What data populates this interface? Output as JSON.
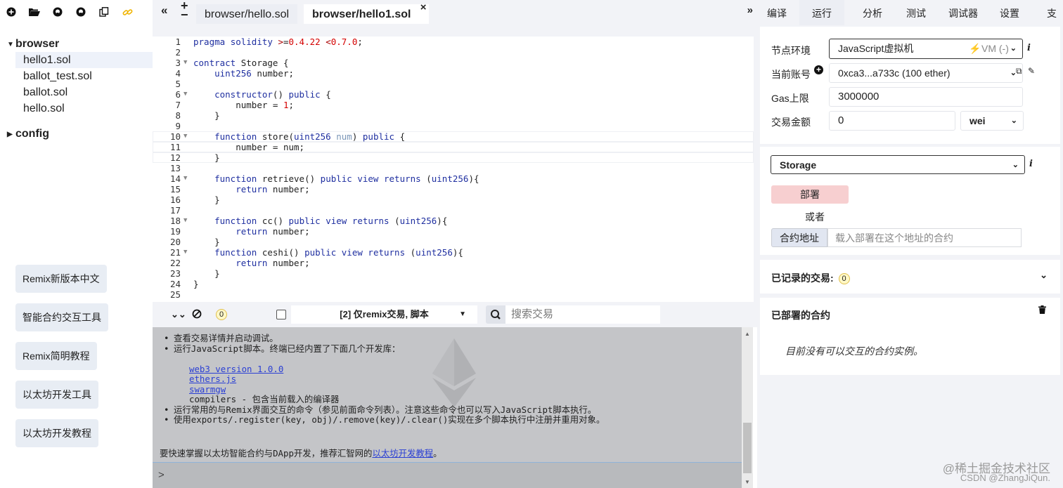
{
  "left_toolbar": {
    "icons": [
      "plus-circle-icon",
      "folder-open-icon",
      "github-icon",
      "github-icon",
      "copy-icon",
      "link-icon"
    ]
  },
  "filetree": {
    "root_folder": "browser",
    "files": [
      "hello1.sol",
      "ballot_test.sol",
      "ballot.sol",
      "hello.sol"
    ],
    "second_folder": "config"
  },
  "side_buttons": [
    "Remix新版本中文",
    "智能合约交互工具",
    "Remix简明教程",
    "以太坊开发工具",
    "以太坊开发教程"
  ],
  "editor": {
    "tabs": [
      {
        "label": "browser/hello.sol"
      },
      {
        "label": "browser/hello1.sol",
        "active": true
      }
    ],
    "close_symbol": "×",
    "lines": [
      "pragma solidity >=0.4.22 <0.7.0;",
      "",
      "contract Storage {",
      "    uint256 number;",
      "",
      "    constructor() public {",
      "        number = 1;",
      "    }",
      "",
      "    function store(uint256 num) public {",
      "        number = num;",
      "    }",
      "",
      "    function retrieve() public view returns (uint256){",
      "        return number;",
      "    }",
      "",
      "    function cc() public view returns (uint256){",
      "        return number;",
      "    }",
      "    function ceshi() public view returns (uint256){",
      "        return number;",
      "    }",
      "}",
      ""
    ]
  },
  "terminal_bar": {
    "pending_count": "0",
    "filter_label": "[2] 仅remix交易, 脚本",
    "search_placeholder": "搜索交易"
  },
  "terminal": {
    "lines": [
      {
        "text": "查看交易详情并启动调试。",
        "type": "bullet"
      },
      {
        "text": "运行JavaScript脚本。终端已经内置了下面几个开发库：",
        "type": "bullet"
      },
      {
        "text": "",
        "type": "blank"
      },
      {
        "text": "web3 version 1.0.0",
        "type": "link"
      },
      {
        "text": "ethers.js",
        "type": "link"
      },
      {
        "text": "swarmgw",
        "type": "link"
      },
      {
        "text": "compilers - 包含当前载入的编译器",
        "type": "sub"
      },
      {
        "text": "运行常用的与Remix界面交互的命令（参见前面命令列表）。注意这些命令也可以写入JavaScript脚本执行。",
        "type": "bullet"
      },
      {
        "text": "使用exports/.register(key, obj)/.remove(key)/.clear()实现在多个脚本执行中注册并重用对象。",
        "type": "bullet"
      }
    ],
    "footer_prefix": "要快速掌握以太坊智能合约与DApp开发，推荐汇智网的",
    "footer_link": "以太坊开发教程",
    "footer_suffix": "。",
    "prompt": ">"
  },
  "right_tabs": [
    "编译",
    "运行",
    "分析",
    "测试",
    "调试器",
    "设置",
    "支持"
  ],
  "run_panel": {
    "env_label": "节点环境",
    "env_value": "JavaScript虚拟机",
    "env_vm": "VM (-)",
    "account_label": "当前账号",
    "account_value": "0xca3...a733c (100 ether)",
    "gas_label": "Gas上限",
    "gas_value": "3000000",
    "value_label": "交易金额",
    "value_amount": "0",
    "value_unit": "wei",
    "contract_value": "Storage",
    "deploy_label": "部署",
    "or_label": "或者",
    "at_address_label": "合约地址",
    "at_address_placeholder": "载入部署在这个地址的合约",
    "recorded_label": "已记录的交易:",
    "recorded_count": "0",
    "deployed_label": "已部署的合约",
    "deployed_empty": "目前没有可以交互的合约实例。"
  },
  "watermark": {
    "line1": "@稀土掘金技术社区",
    "line2": "CSDN @ZhangJiQun."
  }
}
